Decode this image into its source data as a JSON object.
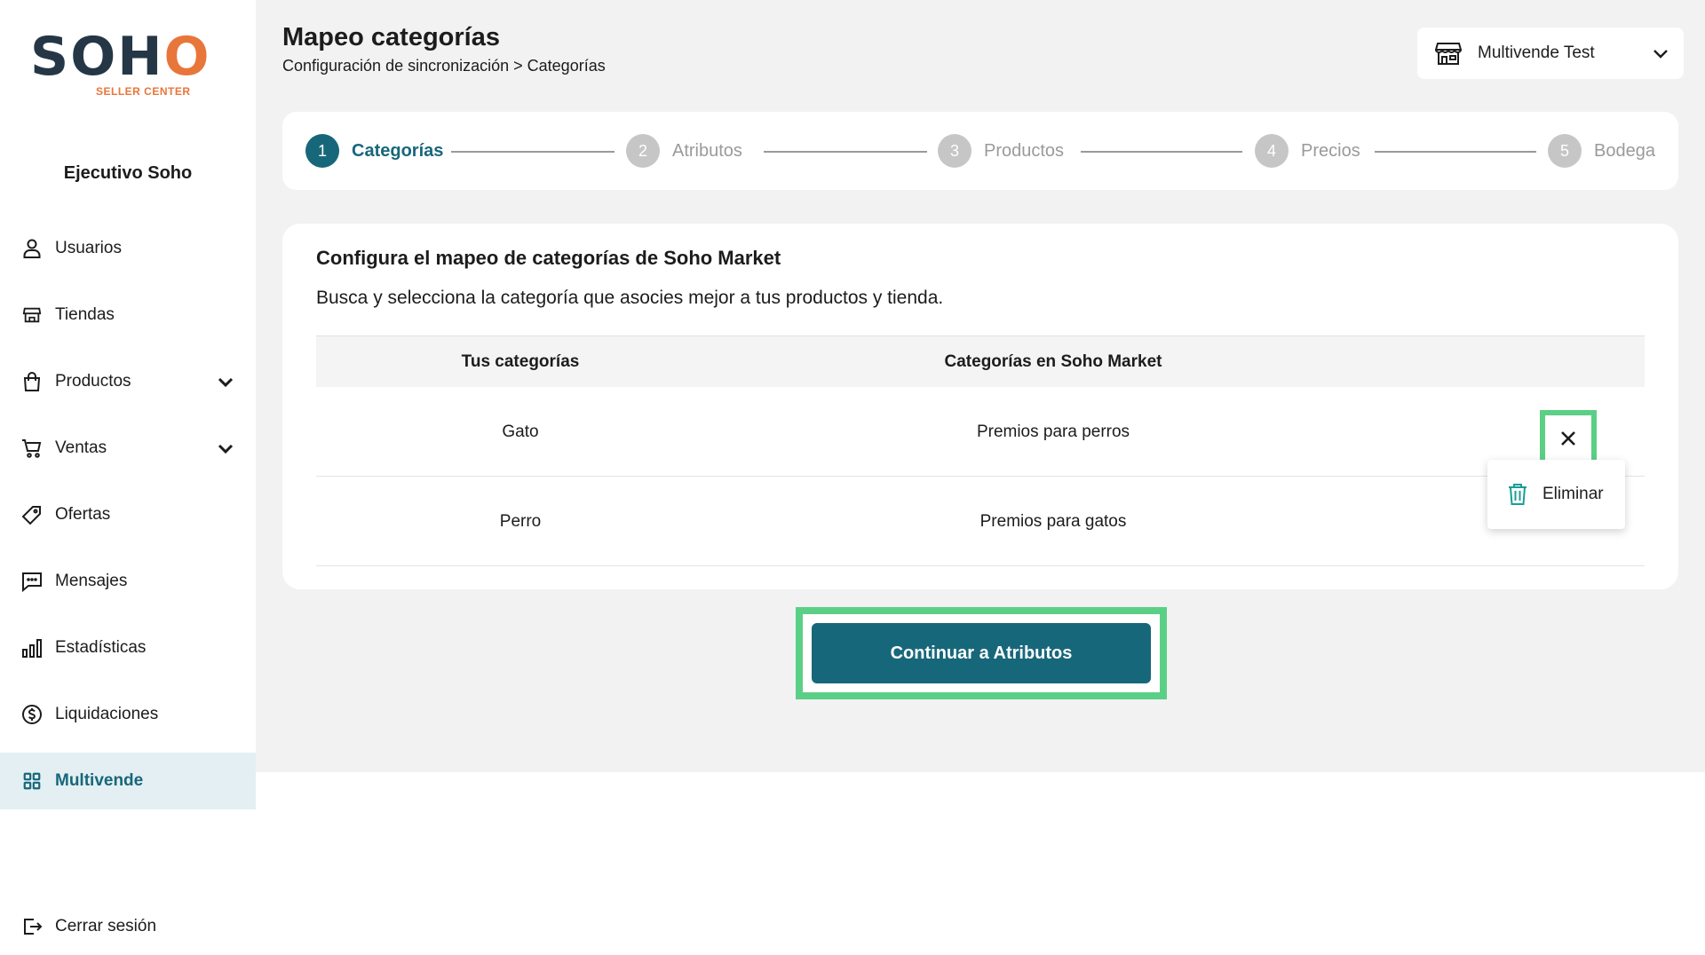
{
  "logo": {
    "main": "SOHO",
    "sub": "SELLER CENTER"
  },
  "sidebar": {
    "user_name": "Ejecutivo Soho",
    "items": [
      {
        "label": "Usuarios",
        "icon": "user-icon",
        "has_chevron": false
      },
      {
        "label": "Tiendas",
        "icon": "store-icon",
        "has_chevron": false
      },
      {
        "label": "Productos",
        "icon": "bag-icon",
        "has_chevron": true
      },
      {
        "label": "Ventas",
        "icon": "cart-icon",
        "has_chevron": true
      },
      {
        "label": "Ofertas",
        "icon": "tag-icon",
        "has_chevron": false
      },
      {
        "label": "Mensajes",
        "icon": "message-icon",
        "has_chevron": false
      },
      {
        "label": "Estadísticas",
        "icon": "bar-chart-icon",
        "has_chevron": false
      },
      {
        "label": "Liquidaciones",
        "icon": "dollar-icon",
        "has_chevron": false
      },
      {
        "label": "Multivende",
        "icon": "grid-icon",
        "has_chevron": false,
        "active": true
      }
    ],
    "logout_label": "Cerrar sesión"
  },
  "header": {
    "title": "Mapeo categorías",
    "breadcrumb": "Configuración de sincronización > Categorías",
    "store_select": "Multivende Test"
  },
  "stepper": {
    "steps": [
      {
        "number": "1",
        "label": "Categorías",
        "active": true
      },
      {
        "number": "2",
        "label": "Atributos",
        "active": false
      },
      {
        "number": "3",
        "label": "Productos",
        "active": false
      },
      {
        "number": "4",
        "label": "Precios",
        "active": false
      },
      {
        "number": "5",
        "label": "Bodega",
        "active": false
      }
    ]
  },
  "card": {
    "title": "Configura el mapeo de categorías de Soho Market",
    "subtitle": "Busca y selecciona la categoría que asocies mejor a tus productos y tienda.",
    "columns": [
      "Tus categorías",
      "Categorías en Soho Market"
    ],
    "rows": [
      {
        "your_category": "Gato",
        "soho_category": "Premios para perros"
      },
      {
        "your_category": "Perro",
        "soho_category": "Premios para gatos"
      }
    ]
  },
  "context_menu": {
    "delete_label": "Eliminar"
  },
  "continue_label": "Continuar a Atributos",
  "colors": {
    "primary": "#17677a",
    "highlight": "#5ccf86",
    "logo_dark": "#253746",
    "logo_accent": "#e8763a"
  }
}
